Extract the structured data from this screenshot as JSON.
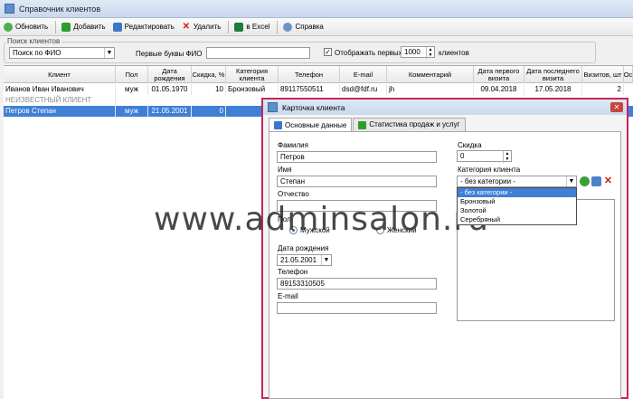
{
  "window": {
    "title": "Справочник клиентов"
  },
  "toolbar": {
    "refresh": "Обновить",
    "add": "Добавить",
    "edit": "Редактировать",
    "delete": "Удалить",
    "excel": "в Excel",
    "help": "Справка"
  },
  "search": {
    "group_label": "Поиск клиентов",
    "mode": "Поиск по ФИО",
    "letters_label": "Первые буквы ФИО",
    "letters_value": "",
    "show_first_label": "Отображать первых",
    "show_first_value": "1000",
    "clients_label": "клиентов"
  },
  "grid": {
    "columns": [
      "Клиент",
      "Пол",
      "Дата рождения",
      "Скидка, %",
      "Категория клиента",
      "Телефон",
      "E-mail",
      "Комментарий",
      "Дата первого визита",
      "Дата последнего визита",
      "Визитов, шт",
      "Ос"
    ],
    "rows": [
      [
        "Иванов Иван Иванович",
        "муж",
        "01.05.1970",
        "10",
        "Бронзовый",
        "89117550511",
        "dsd@fdf.ru",
        "jh",
        "09.04.2018",
        "17.05.2018",
        "2",
        ""
      ],
      [
        "НЕИЗВЕСТНЫЙ КЛИЕНТ",
        "",
        "",
        "",
        "",
        "",
        "",
        "",
        "",
        "",
        "",
        ""
      ],
      [
        "Петров Степан",
        "муж",
        "21.05.2001",
        "0",
        "",
        "",
        "",
        "",
        "",
        "",
        "",
        ""
      ]
    ]
  },
  "dialog": {
    "title": "Карточка клиента",
    "tabs": [
      "Основные данные",
      "Статистика продаж и услуг"
    ],
    "lastname_label": "Фамилия",
    "lastname": "Петров",
    "firstname_label": "Имя",
    "firstname": "Степан",
    "middlename_label": "Отчество",
    "middlename": "",
    "gender_label": "Пол",
    "male": "Мужской",
    "female": "Женский",
    "birth_label": "Дата рождения",
    "birth": "21.05.2001",
    "phone_label": "Телефон",
    "phone": "89153310505",
    "email_label": "E-mail",
    "email": "",
    "discount_label": "Скидка",
    "discount": "0",
    "category_label": "Категория клиента",
    "category": "- без категории -",
    "category_options": [
      "- без категории -",
      "Бронзовый",
      "Золотой",
      "Серебряный"
    ]
  },
  "watermark": "www.adminsalon.ru"
}
